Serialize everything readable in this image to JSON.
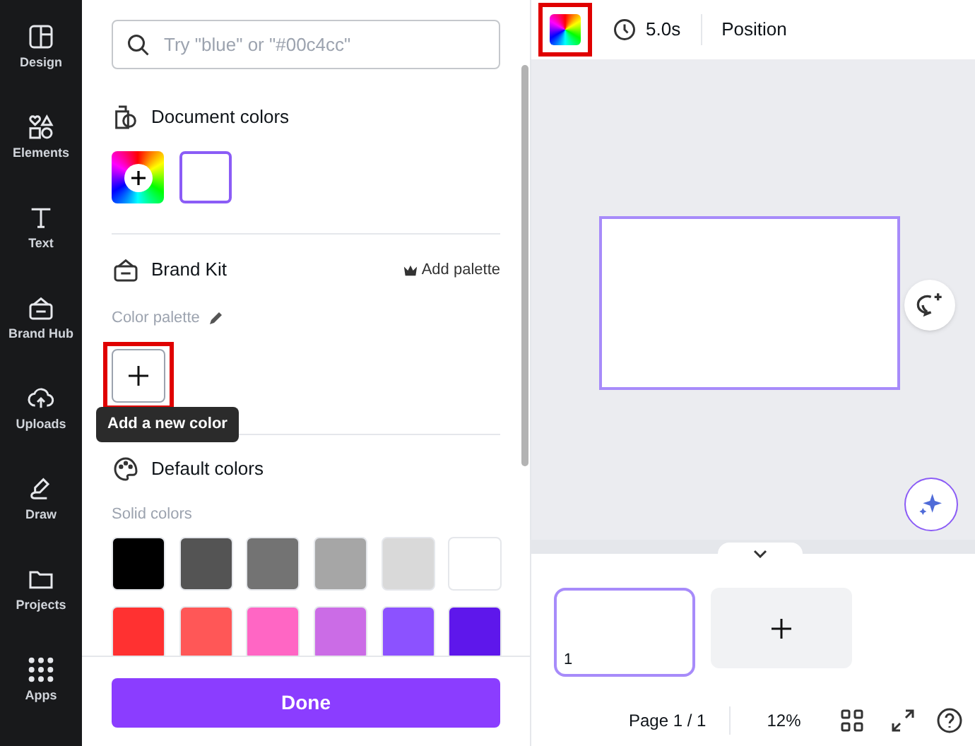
{
  "sidebar": {
    "items": [
      {
        "label": "Design",
        "kind": "design"
      },
      {
        "label": "Elements",
        "kind": "elements"
      },
      {
        "label": "Text",
        "kind": "text"
      },
      {
        "label": "Brand Hub",
        "kind": "brand"
      },
      {
        "label": "Uploads",
        "kind": "uploads"
      },
      {
        "label": "Draw",
        "kind": "draw"
      },
      {
        "label": "Projects",
        "kind": "projects"
      },
      {
        "label": "Apps",
        "kind": "apps"
      }
    ]
  },
  "panel": {
    "search": {
      "placeholder": "Try \"blue\" or \"#00c4cc\""
    },
    "document_colors": {
      "title": "Document colors",
      "swatches": [
        {
          "color": "#ffffff"
        }
      ]
    },
    "brand_kit": {
      "title": "Brand Kit",
      "add_palette": "Add palette",
      "palette_label": "Color palette",
      "add_color_highlighted": true,
      "tooltip": "Add a new color"
    },
    "default_colors": {
      "title": "Default colors",
      "subtitle": "Solid colors",
      "swatches": [
        {
          "color": "#000000"
        },
        {
          "color": "#545454"
        },
        {
          "color": "#737373"
        },
        {
          "color": "#a6a6a6"
        },
        {
          "color": "#d9d9d9"
        },
        {
          "color": "#ffffff"
        },
        {
          "color": "#ff3131"
        },
        {
          "color": "#ff5757"
        },
        {
          "color": "#ff66c4"
        },
        {
          "color": "#cb6ce6"
        },
        {
          "color": "#8c52ff"
        },
        {
          "color": "#5e17eb"
        }
      ]
    },
    "done": "Done"
  },
  "toolbar": {
    "color_highlighted": true,
    "duration": "5.0s",
    "position": "Position"
  },
  "pages": [
    {
      "number": "1",
      "selected": true
    }
  ],
  "footer": {
    "page": "Page 1 / 1",
    "zoom": "12%"
  }
}
